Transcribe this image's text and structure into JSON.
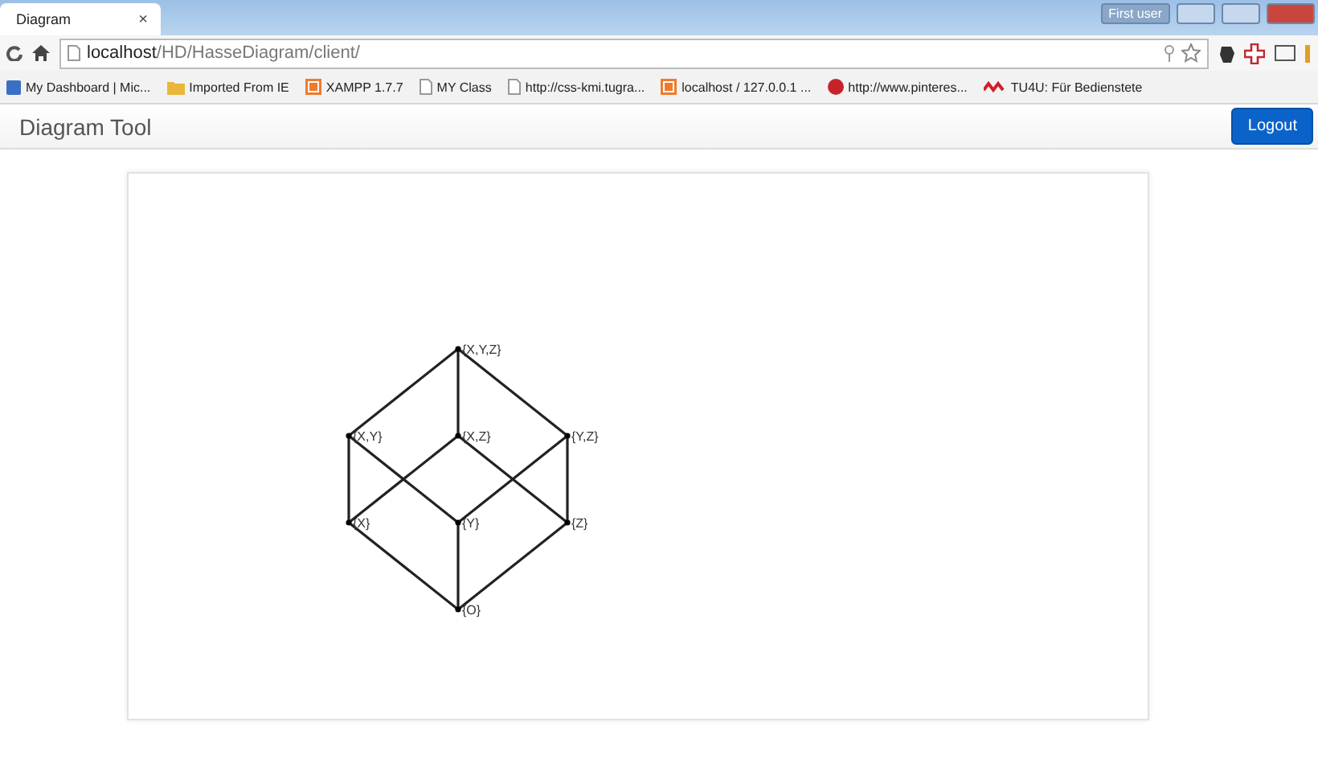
{
  "browser": {
    "tab": {
      "title": "Diagram",
      "close": "×"
    },
    "user_badge": "First user",
    "address": {
      "host": "localhost",
      "path": "/HD/HasseDiagram/client/"
    },
    "bookmarks": [
      {
        "label": "My Dashboard | Mic...",
        "kind": "site"
      },
      {
        "label": "Imported From IE",
        "kind": "folder"
      },
      {
        "label": "XAMPP 1.7.7",
        "kind": "xampp"
      },
      {
        "label": "MY Class",
        "kind": "page"
      },
      {
        "label": "http://css-kmi.tugra...",
        "kind": "page"
      },
      {
        "label": "localhost / 127.0.0.1 ...",
        "kind": "xampp"
      },
      {
        "label": "http://www.pinteres...",
        "kind": "pin"
      },
      {
        "label": "TU4U: Für Bedienstete",
        "kind": "tu"
      }
    ]
  },
  "app_header": {
    "title": "Diagram Tool",
    "logout": "Logout"
  },
  "diagram": {
    "levels": [
      [
        "{X,Y,Z}"
      ],
      [
        "{X,Y}",
        "{X,Z}",
        "{Y,Z}"
      ],
      [
        "{X}",
        "{Y}",
        "{Z}"
      ],
      [
        "{O}"
      ]
    ]
  }
}
